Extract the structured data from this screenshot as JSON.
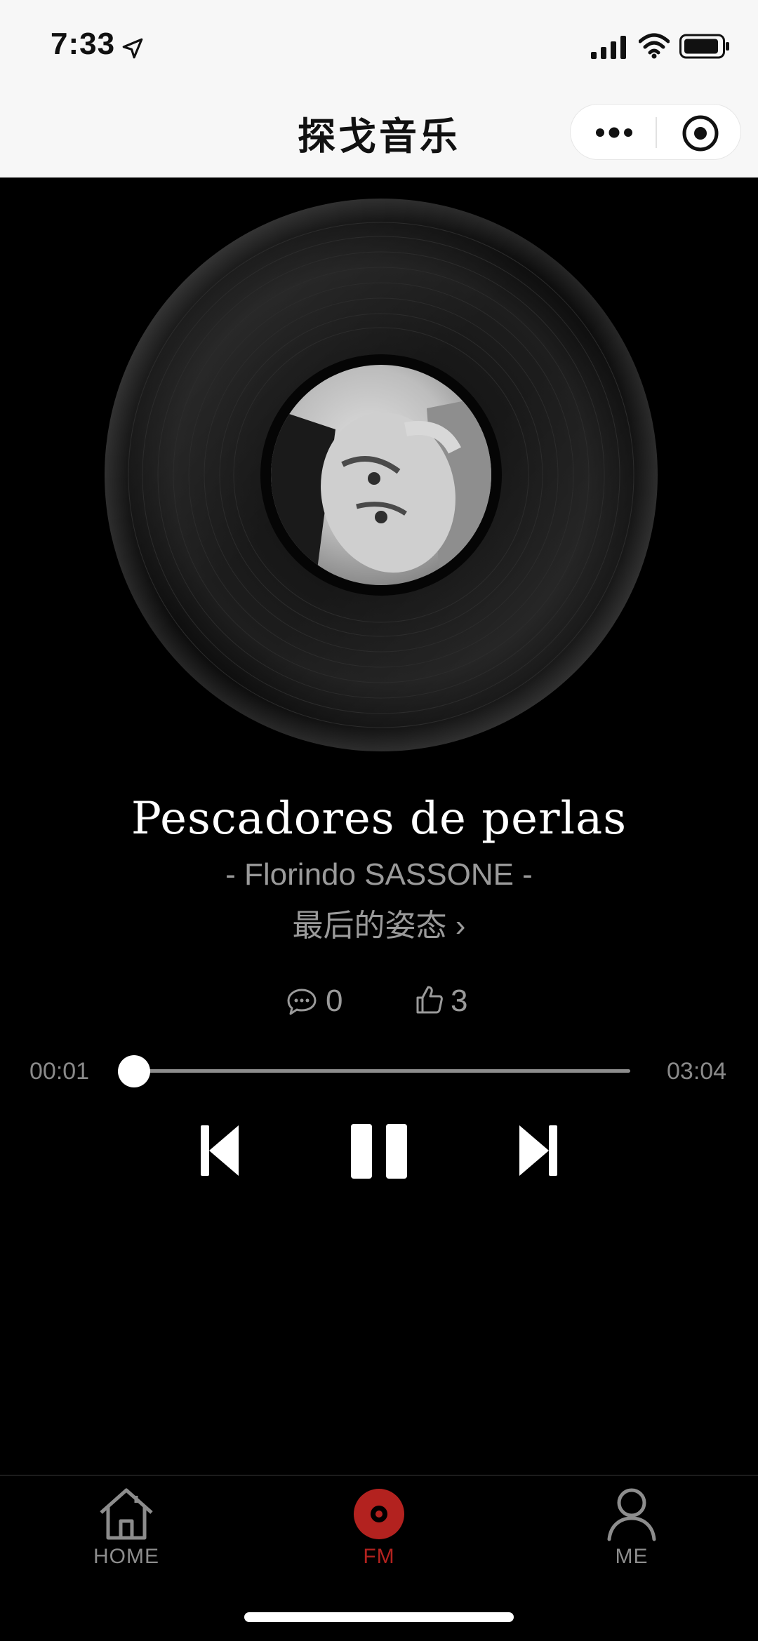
{
  "status_bar": {
    "time": "7:33",
    "icons": [
      "location-arrow-icon",
      "signal-icon",
      "wifi-icon",
      "battery-icon"
    ]
  },
  "nav": {
    "title": "探戈音乐",
    "capsule_icons": [
      "more-icon",
      "target-icon"
    ]
  },
  "player": {
    "song_title": "Pescadores de perlas",
    "artist": "- Florindo SASSONE -",
    "album": "最后的姿态 ›",
    "comments": "0",
    "likes": "3",
    "current_time": "00:01",
    "total_time": "03:04",
    "progress_fraction": 0.01,
    "controls": [
      "previous-icon",
      "pause-icon",
      "next-icon"
    ]
  },
  "tabbar": {
    "items": [
      {
        "label": "HOME",
        "icon": "house-icon",
        "active": false
      },
      {
        "label": "FM",
        "icon": "record-icon",
        "active": true
      },
      {
        "label": "ME",
        "icon": "person-icon",
        "active": false
      }
    ],
    "active_color": "#b3221f",
    "inactive_color": "#8d8d8d"
  }
}
